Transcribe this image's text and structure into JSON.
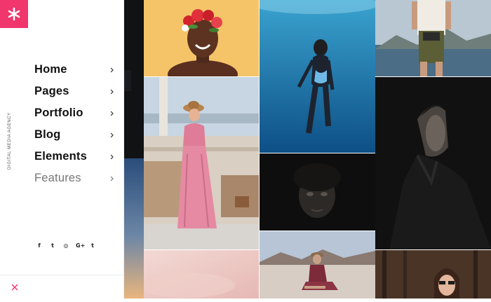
{
  "brand": {
    "logo_symbol": "*",
    "tagline": "DIGITAL MEDIA AGENCY",
    "accent": "#f0366d"
  },
  "nav": {
    "items": [
      {
        "label": "Home"
      },
      {
        "label": "Pages"
      },
      {
        "label": "Portfolio"
      },
      {
        "label": "Blog"
      },
      {
        "label": "Elements"
      },
      {
        "label": "Features"
      }
    ],
    "chevron": "›"
  },
  "social": [
    "f",
    "t",
    "◎",
    "G+",
    "t"
  ],
  "close_icon": "close-x-icon",
  "gallery": {
    "tiles": [
      "woman-flower-crown-yellow-backdrop",
      "diver-underwater",
      "woman-backpack-coast",
      "woman-pink-dress-hat-by-wall",
      "man-profile-dark-portrait",
      "woman-face-in-shadow",
      "woman-sitting-desert",
      "woman-sunglasses-forest",
      "pastel-sky"
    ]
  }
}
